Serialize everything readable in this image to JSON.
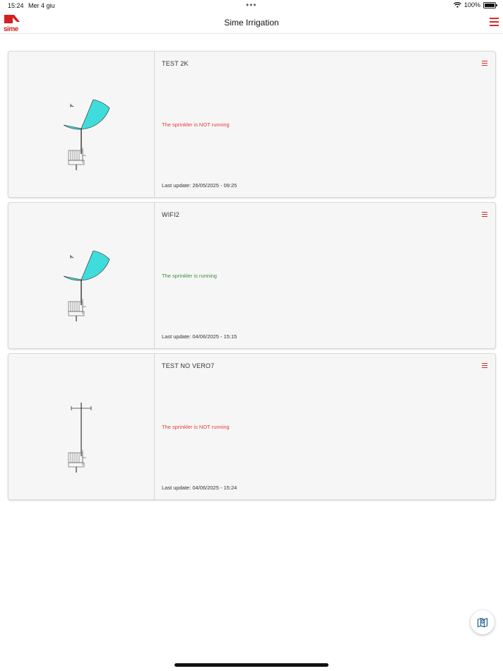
{
  "status_bar": {
    "time": "15:24",
    "date": "Mer 4 giu",
    "battery": "100%"
  },
  "header": {
    "logo_text": "sime",
    "title": "Sime Irrigation"
  },
  "colors": {
    "accent": "#d42a2a",
    "spray_fill": "#40dcdc",
    "running": "#3a8f3a",
    "not_running": "#e33b3b"
  },
  "cards": [
    {
      "name": "TEST 2K",
      "status": "The sprinkler is NOT running",
      "running": false,
      "spray_visible": true,
      "last_update": "Last update: 26/05/2025 - 09:25"
    },
    {
      "name": "WIFI2",
      "status": "The sprinkler is running",
      "running": true,
      "spray_visible": true,
      "last_update": "Last update: 04/06/2025 - 15:15"
    },
    {
      "name": "TEST NO VERO7",
      "status": "The sprinkler is NOT running",
      "running": false,
      "spray_visible": false,
      "last_update": "Last update: 04/06/2025 - 15:24"
    }
  ],
  "fab_icon": "map-pin-icon"
}
